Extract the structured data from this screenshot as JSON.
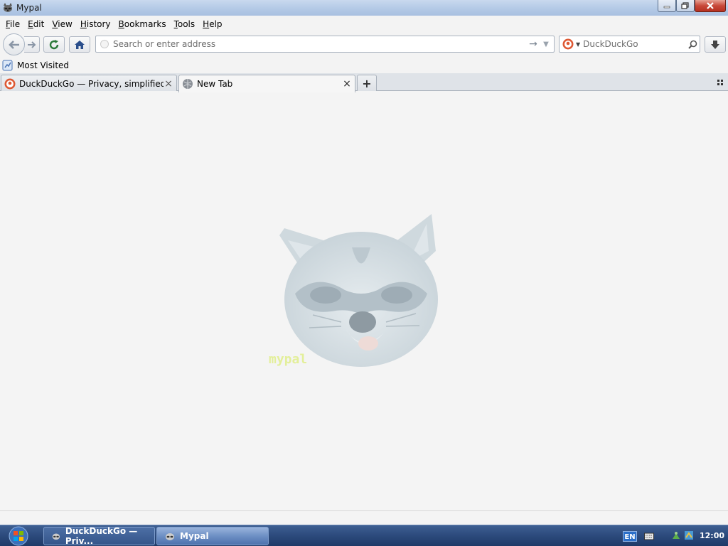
{
  "window": {
    "title": "Mypal"
  },
  "menu": {
    "items": [
      {
        "key": "F",
        "rest": "ile"
      },
      {
        "key": "E",
        "rest": "dit"
      },
      {
        "key": "V",
        "rest": "iew"
      },
      {
        "key": "H",
        "rest": "istory",
        "prefix": ""
      },
      {
        "key": "B",
        "rest": "ookmarks"
      },
      {
        "key": "T",
        "rest": "ools"
      },
      {
        "key": "H",
        "rest": "elp"
      }
    ]
  },
  "navbar": {
    "url_placeholder": "Search or enter address",
    "search_placeholder": "DuckDuckGo"
  },
  "bookmarks": {
    "most_visited": "Most Visited"
  },
  "tabs": [
    {
      "label": "DuckDuckGo — Privacy, simplified.",
      "active": false
    },
    {
      "label": "New Tab",
      "active": true
    }
  ],
  "content": {
    "watermark_text": "mypal"
  },
  "taskbar": {
    "items": [
      {
        "label": "DuckDuckGo — Priv..."
      },
      {
        "label": "Mypal"
      }
    ],
    "language": "EN",
    "clock": "12:00"
  },
  "colors": {
    "accent": "#3e5f92",
    "ddg_orange": "#de5833"
  }
}
